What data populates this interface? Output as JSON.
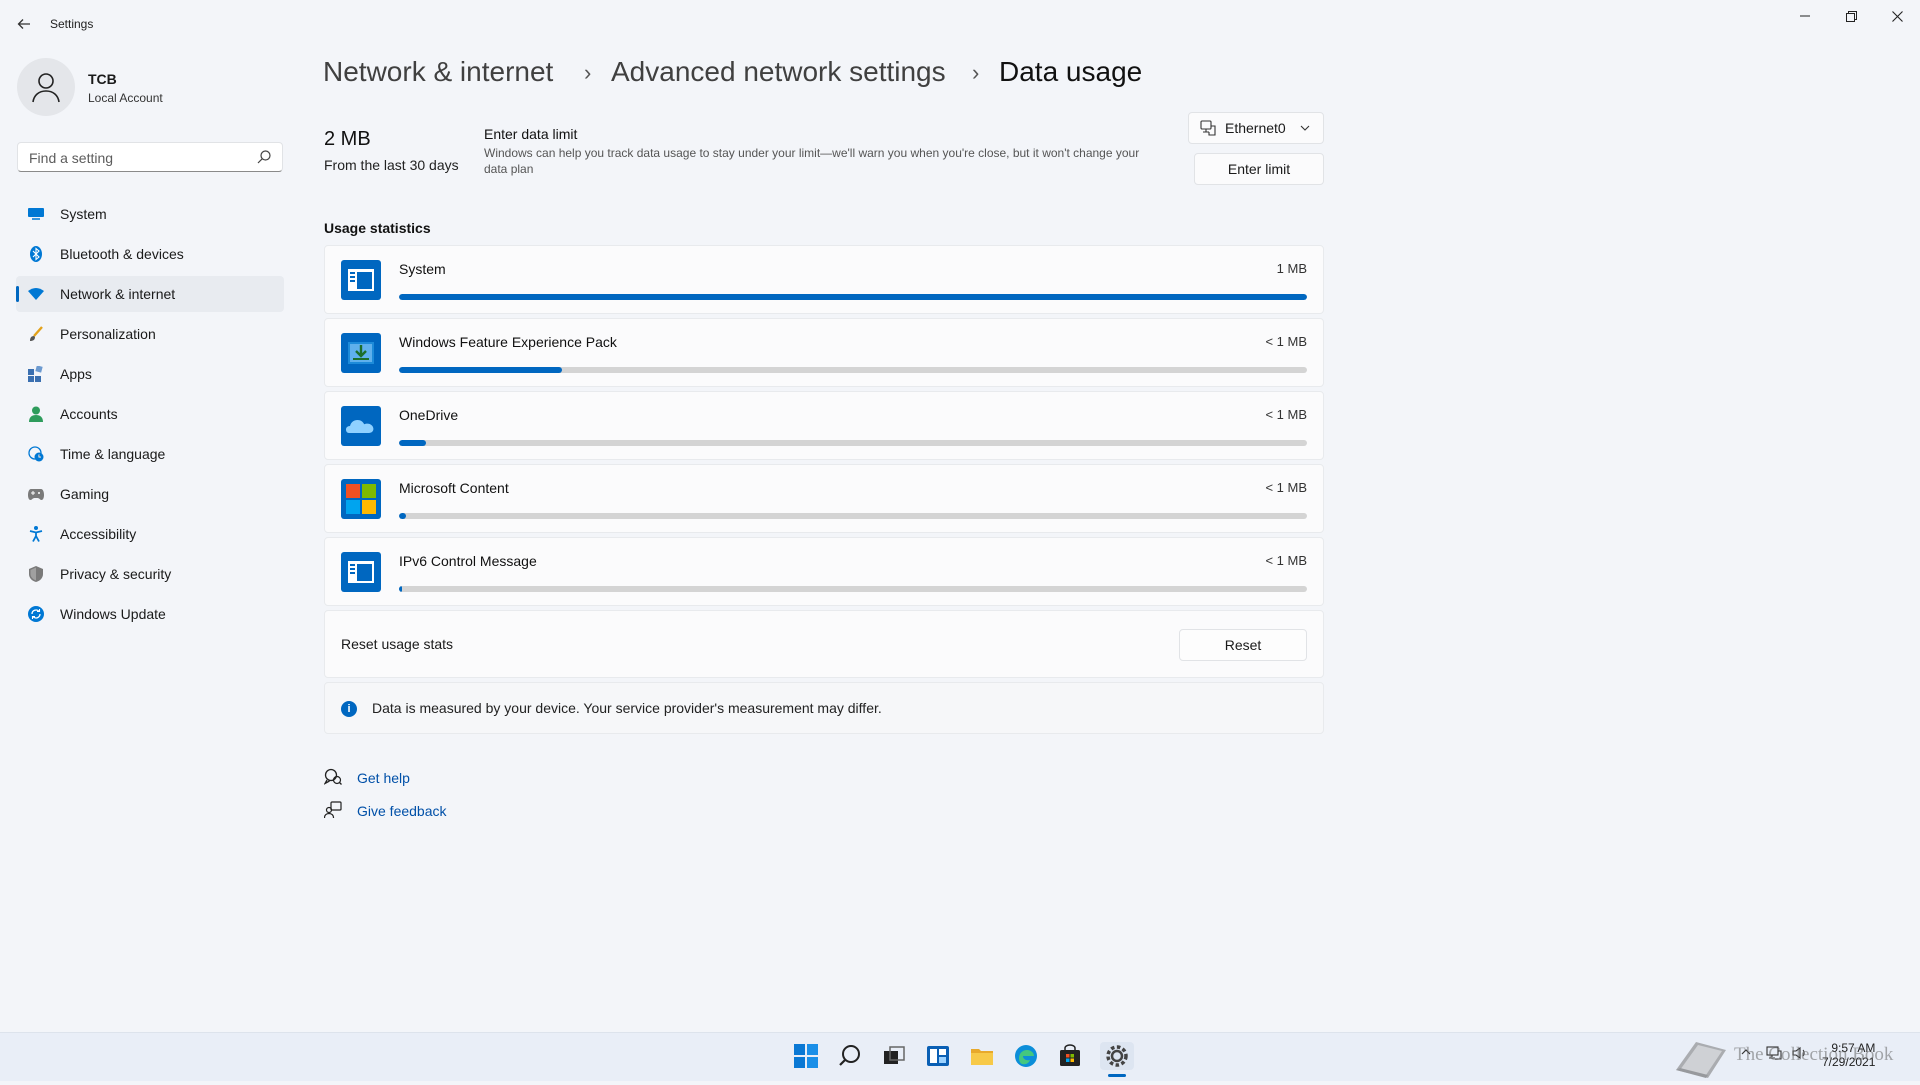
{
  "window": {
    "title": "Settings",
    "back_icon": "arrow-left-icon",
    "controls": [
      "minimize-icon",
      "restore-icon",
      "close-icon"
    ]
  },
  "user": {
    "name": "TCB",
    "account_type": "Local Account",
    "avatar_icon": "person-icon"
  },
  "search": {
    "placeholder": "Find a setting",
    "value": ""
  },
  "sidebar": {
    "items": [
      {
        "label": "System",
        "icon": "monitor-icon",
        "active": false
      },
      {
        "label": "Bluetooth & devices",
        "icon": "bluetooth-icon",
        "active": false
      },
      {
        "label": "Network & internet",
        "icon": "wifi-icon",
        "active": true
      },
      {
        "label": "Personalization",
        "icon": "brush-icon",
        "active": false
      },
      {
        "label": "Apps",
        "icon": "apps-icon",
        "active": false
      },
      {
        "label": "Accounts",
        "icon": "person-icon",
        "active": false
      },
      {
        "label": "Time & language",
        "icon": "globe-clock-icon",
        "active": false
      },
      {
        "label": "Gaming",
        "icon": "gamepad-icon",
        "active": false
      },
      {
        "label": "Accessibility",
        "icon": "accessibility-icon",
        "active": false
      },
      {
        "label": "Privacy & security",
        "icon": "shield-icon",
        "active": false
      },
      {
        "label": "Windows Update",
        "icon": "update-icon",
        "active": false
      }
    ]
  },
  "breadcrumb": {
    "items": [
      "Network & internet",
      "Advanced network settings",
      "Data usage"
    ],
    "separator": "›"
  },
  "summary": {
    "total": "2 MB",
    "period": "From the last 30 days",
    "limit_title": "Enter data limit",
    "limit_description": "Windows can help you track data usage to stay under your limit—we'll warn you when you're close, but it won't change your data plan",
    "adapter": "Ethernet0",
    "enter_limit_label": "Enter limit"
  },
  "usage": {
    "title": "Usage statistics",
    "apps": [
      {
        "name": "System",
        "usage": "1 MB",
        "fraction": 1.0,
        "icon": "system-app-icon"
      },
      {
        "name": "Windows Feature Experience Pack",
        "usage": "< 1 MB",
        "fraction": 0.18,
        "icon": "feature-pack-icon"
      },
      {
        "name": "OneDrive",
        "usage": "< 1 MB",
        "fraction": 0.03,
        "icon": "onedrive-icon"
      },
      {
        "name": "Microsoft Content",
        "usage": "< 1 MB",
        "fraction": 0.008,
        "icon": "microsoft-logo-icon"
      },
      {
        "name": "IPv6 Control Message",
        "usage": "< 1 MB",
        "fraction": 0.002,
        "icon": "system-app-icon"
      }
    ]
  },
  "reset": {
    "label": "Reset usage stats",
    "button": "Reset"
  },
  "info": {
    "text": "Data is measured by your device. Your service provider's measurement may differ."
  },
  "help_links": [
    {
      "label": "Get help",
      "icon": "help-chat-icon"
    },
    {
      "label": "Give feedback",
      "icon": "feedback-icon"
    }
  ],
  "taskbar": {
    "apps": [
      "start-icon",
      "search-icon",
      "task-view-icon",
      "widgets-icon",
      "file-explorer-icon",
      "edge-icon",
      "store-icon",
      "settings-icon"
    ],
    "tray": [
      "chevron-up-icon",
      "network-icon",
      "volume-icon"
    ],
    "time": "9:57 AM",
    "date": "7/29/2021"
  },
  "watermark": {
    "text": "The Collection Book"
  },
  "colors": {
    "accent": "#0067c0",
    "background": "#f3f5f9",
    "card": "#fbfbfc"
  }
}
